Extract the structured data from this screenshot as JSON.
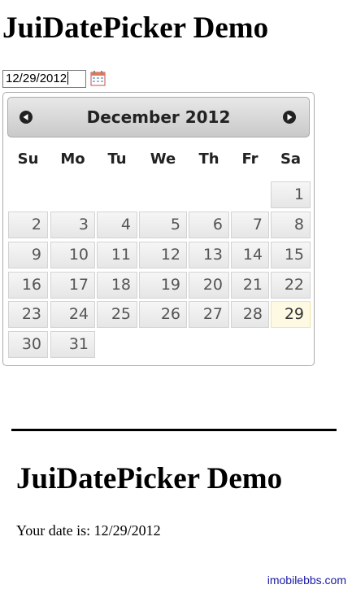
{
  "page": {
    "title": "JuiDatePicker Demo",
    "footer": "imobilebbs.com"
  },
  "input": {
    "value": "12/29/2012"
  },
  "icons": {
    "trigger": "calendar-icon",
    "prev": "circle-triangle-left-icon",
    "next": "circle-triangle-right-icon"
  },
  "datepicker": {
    "month_title": "December 2012",
    "weekdays": [
      "Su",
      "Mo",
      "Tu",
      "We",
      "Th",
      "Fr",
      "Sa"
    ],
    "days": [
      "1",
      "2",
      "3",
      "4",
      "5",
      "6",
      "7",
      "8",
      "9",
      "10",
      "11",
      "12",
      "13",
      "14",
      "15",
      "16",
      "17",
      "18",
      "19",
      "20",
      "21",
      "22",
      "23",
      "24",
      "25",
      "26",
      "27",
      "28",
      "29",
      "30",
      "31"
    ],
    "selected_day": "29"
  },
  "result": {
    "heading": "JuiDatePicker Demo",
    "label": "Your date is: 12/29/2012"
  },
  "colors": {
    "highlight_bg": "#fdf9e2",
    "header_bg": "#d6d6d6"
  }
}
